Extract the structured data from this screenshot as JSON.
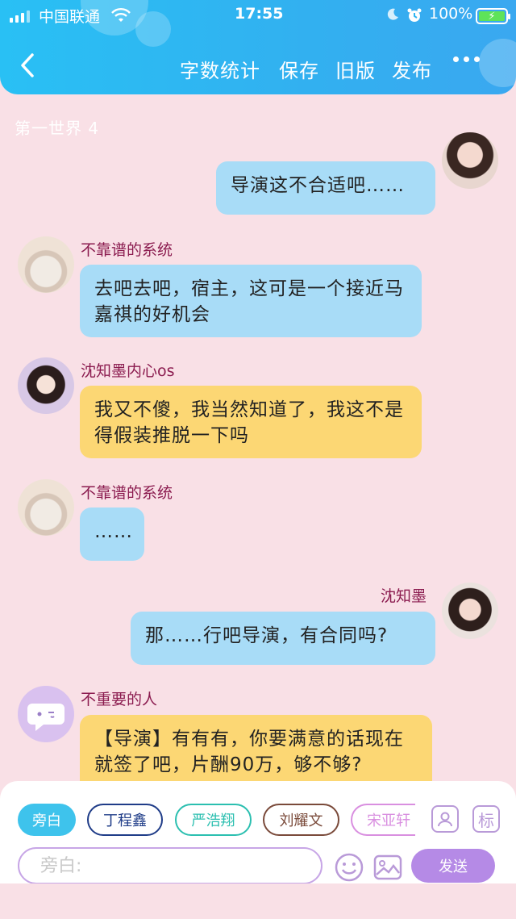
{
  "status_bar": {
    "carrier": "中国联通",
    "time": "17:55",
    "battery": "100%"
  },
  "nav": {
    "word_count": "字数统计",
    "save": "保存",
    "old_version": "旧版",
    "publish": "发布"
  },
  "chapter_title": "第一世界 4",
  "messages": [
    {
      "side": "right",
      "name": "",
      "text": "导演这不合适吧……",
      "color": "blue"
    },
    {
      "side": "left",
      "name": "不靠谱的系统",
      "text": "去吧去吧，宿主，这可是一个接近马嘉祺的好机会",
      "color": "blue"
    },
    {
      "side": "left",
      "name": "沈知墨内心os",
      "text": "我又不傻，我当然知道了，我这不是得假装推脱一下吗",
      "color": "yellow"
    },
    {
      "side": "left",
      "name": "不靠谱的系统",
      "text": "……",
      "color": "blue"
    },
    {
      "side": "right",
      "name": "沈知墨",
      "text": "那……行吧导演，有合同吗?",
      "color": "blue"
    },
    {
      "side": "left",
      "name": "不重要的人",
      "text": "【导演】有有有，你要满意的话现在就签了吧，片酬90万，够不够?",
      "color": "yellow"
    }
  ],
  "roles": [
    {
      "label": "旁白",
      "color": "#3ec3ec"
    },
    {
      "label": "丁程鑫",
      "color": "#1f3c88"
    },
    {
      "label": "严浩翔",
      "color": "#2bbfb0"
    },
    {
      "label": "刘耀文",
      "color": "#7a4a3a"
    },
    {
      "label": "宋亚轩",
      "color": "#d98fe0"
    }
  ],
  "tools": {
    "mark_label": "标"
  },
  "input": {
    "placeholder": "旁白:"
  },
  "send_label": "发送"
}
